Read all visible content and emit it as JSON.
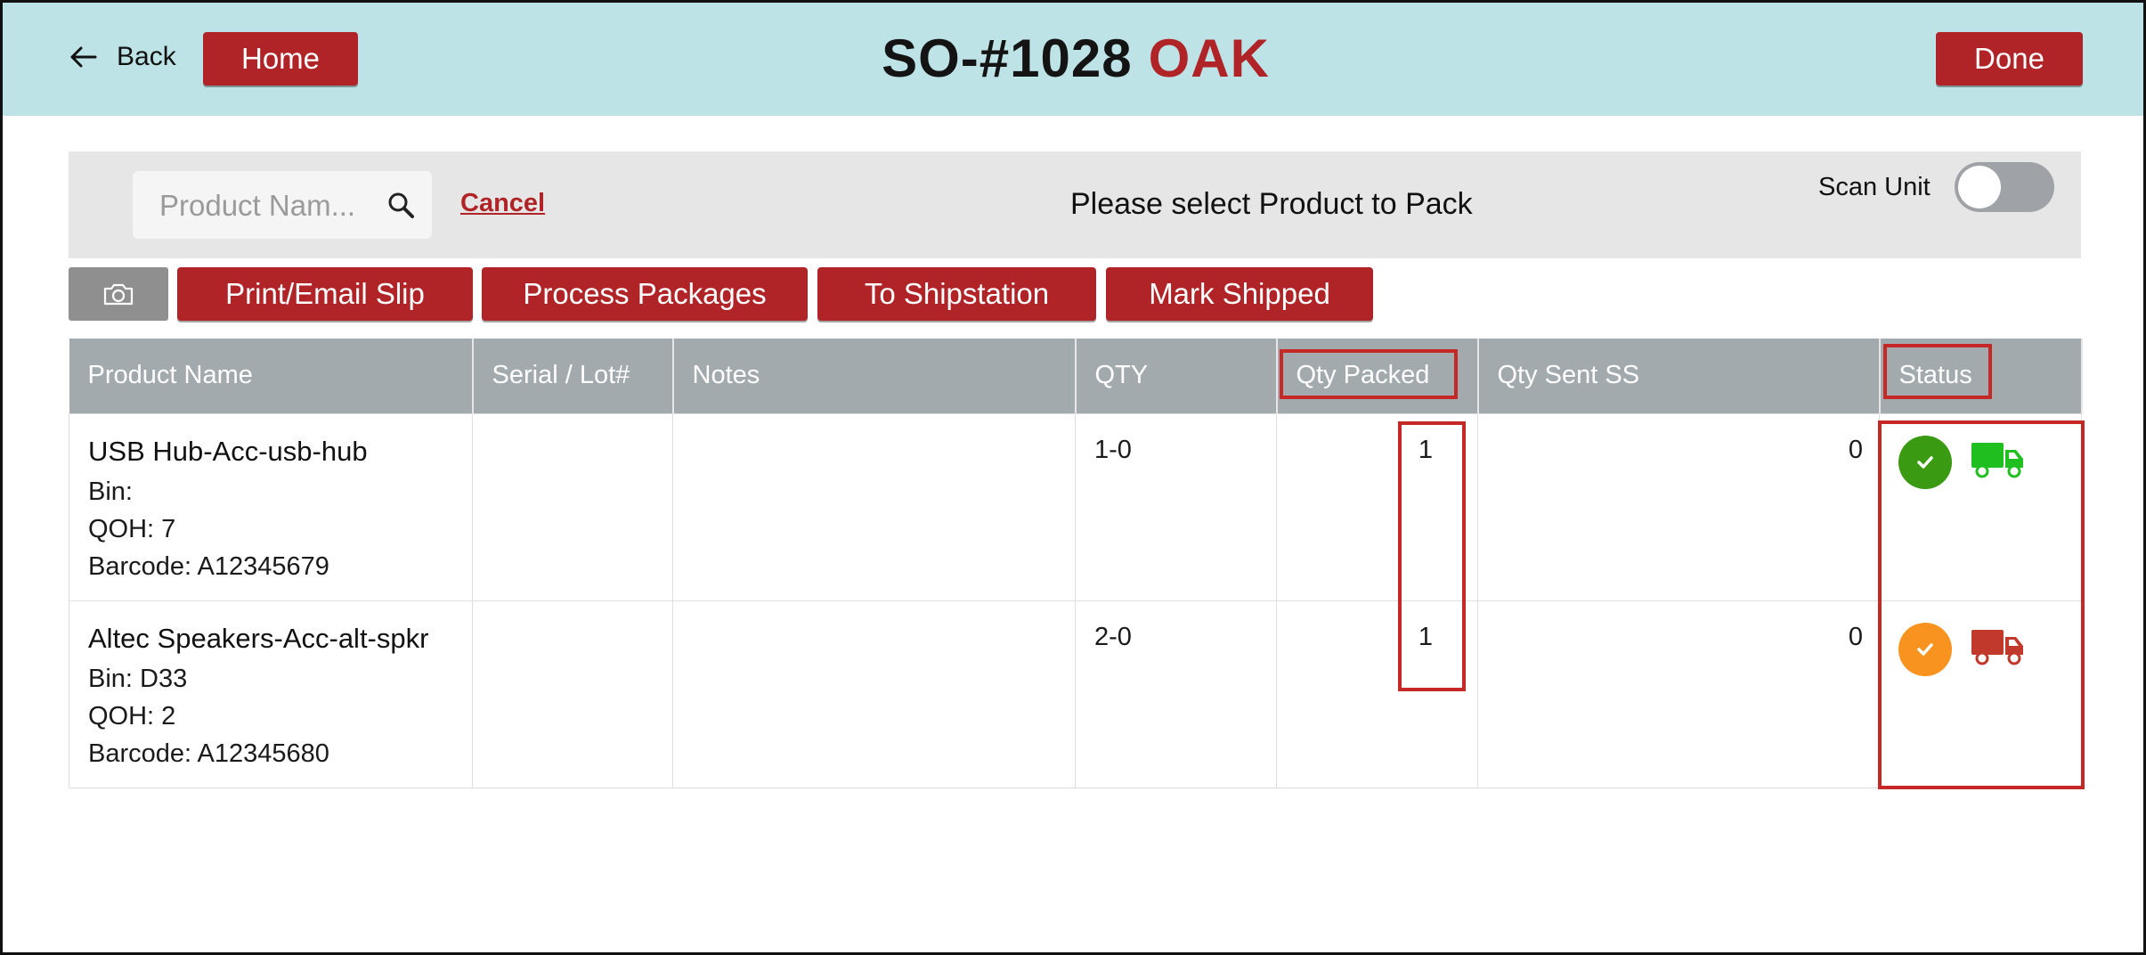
{
  "header": {
    "back_label": "Back",
    "home_label": "Home",
    "title_code": "SO-#1028",
    "title_location": "OAK",
    "done_label": "Done"
  },
  "searchbar": {
    "placeholder": "Product Nam...",
    "cancel_label": "Cancel",
    "prompt": "Please select Product to Pack",
    "scan_unit_label": "Scan Unit",
    "scan_unit_on": false
  },
  "actions": {
    "camera_icon": "camera-icon",
    "print_label": "Print/Email Slip",
    "process_label": "Process Packages",
    "shipstation_label": "To Shipstation",
    "mark_shipped_label": "Mark Shipped"
  },
  "table": {
    "columns": [
      "Product Name",
      "Serial / Lot#",
      "Notes",
      "QTY",
      "Qty Packed",
      "Qty Sent SS",
      "Status"
    ],
    "rows": [
      {
        "name": "USB Hub-Acc-usb-hub",
        "bin": "Bin:",
        "qoh": "QOH: 7",
        "barcode": "Barcode: A12345679",
        "serial": "",
        "notes": "",
        "qty": "1-0",
        "qty_packed": "1",
        "qty_sent_ss": "0",
        "status_color": "#3a9a12",
        "truck_color": "#1fbf1f"
      },
      {
        "name": "Altec Speakers-Acc-alt-spkr",
        "bin": "Bin: D33",
        "qoh": "QOH: 2",
        "barcode": "Barcode: A12345680",
        "serial": "",
        "notes": "",
        "qty": "2-0",
        "qty_packed": "1",
        "qty_sent_ss": "0",
        "status_color": "#f7931e",
        "truck_color": "#c0392b"
      }
    ]
  },
  "colors": {
    "accent": "#b02428",
    "header_bg": "#bde3e6",
    "table_header_bg": "#a3aaad"
  }
}
